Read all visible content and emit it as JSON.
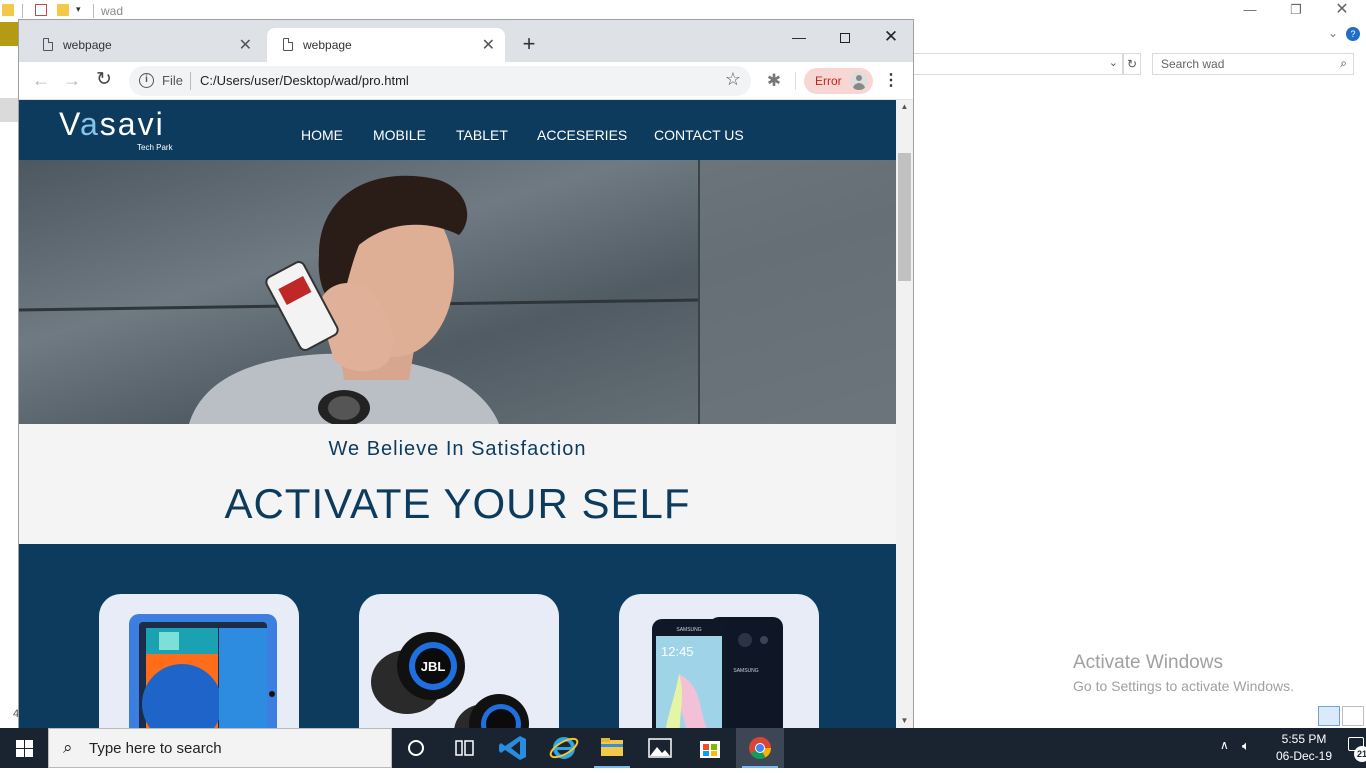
{
  "explorer": {
    "title": "wad",
    "search_placeholder": "Search wad",
    "left_fragment": "4"
  },
  "activation": {
    "title": "Activate Windows",
    "subtitle": "Go to Settings to activate Windows."
  },
  "browser": {
    "tabs": [
      {
        "label": "webpage",
        "active": false
      },
      {
        "label": "webpage",
        "active": true
      }
    ],
    "file_label": "File",
    "url": "C:/Users/user/Desktop/wad/pro.html",
    "profile_status": "Error"
  },
  "page": {
    "logo": {
      "first_letter": "V",
      "accent_letter": "a",
      "rest": "savi",
      "subtitle": "Tech Park"
    },
    "nav": [
      "HOME",
      "MOBILE",
      "TABLET",
      "ACCESERIES",
      "CONTACT US"
    ],
    "tagline": "We Believe In Satisfaction",
    "headline": "ACTIVATE YOUR SELF",
    "products": [
      {
        "name": "tablet",
        "brand": ""
      },
      {
        "name": "earbuds",
        "brand": "JBL"
      },
      {
        "name": "smartphone",
        "brand": "SAMSUNG",
        "screen_time": "12:45"
      }
    ],
    "colors": {
      "primary": "#0d3b5e",
      "accent": "#84c5ea",
      "card": "#e7ecf6"
    }
  },
  "taskbar": {
    "search_placeholder": "Type here to search",
    "apps": [
      "task-view",
      "vscode",
      "internet-explorer",
      "file-explorer",
      "photos",
      "store",
      "chrome"
    ],
    "time": "5:55 PM",
    "date": "06-Dec-19",
    "notification_count": "21"
  }
}
